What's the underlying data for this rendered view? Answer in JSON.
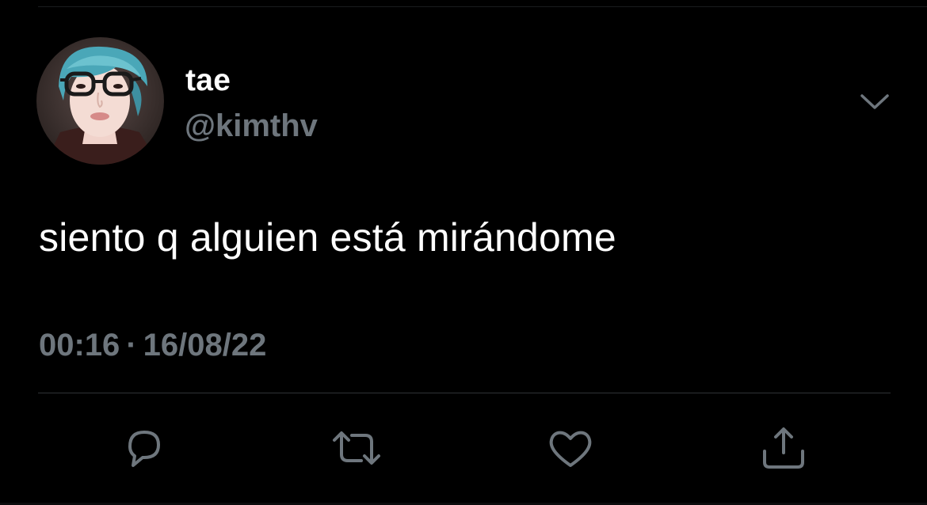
{
  "author": {
    "display_name": "tae",
    "handle": "@kimthv",
    "avatar_icon": "profile-photo"
  },
  "tweet": {
    "text": "siento q alguien está mirándome",
    "time": "00:16",
    "separator": "·",
    "date": "16/08/22"
  },
  "actions": [
    {
      "name": "reply",
      "icon": "reply-icon"
    },
    {
      "name": "retweet",
      "icon": "retweet-icon"
    },
    {
      "name": "like",
      "icon": "heart-icon"
    },
    {
      "name": "share",
      "icon": "share-icon"
    }
  ],
  "menu": {
    "icon": "chevron-down-icon"
  },
  "colors": {
    "background": "#000000",
    "primary_text": "#ffffff",
    "secondary_text": "#6e767d",
    "divider": "#2f3336"
  }
}
